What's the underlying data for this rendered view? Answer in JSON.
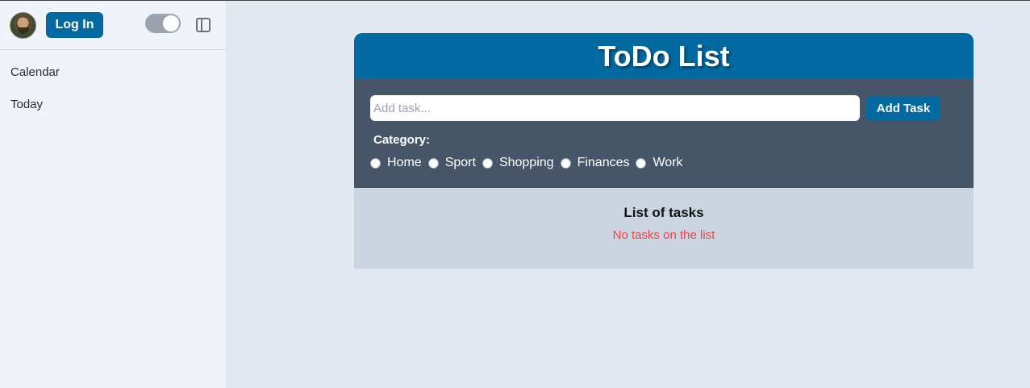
{
  "header": {
    "login_label": "Log In"
  },
  "sidebar": {
    "items": [
      {
        "label": "Calendar"
      },
      {
        "label": "Today"
      }
    ]
  },
  "todo": {
    "title": "ToDo List",
    "input_placeholder": "Add task...",
    "add_button_label": "Add Task",
    "category_label": "Category:",
    "categories": [
      {
        "label": "Home"
      },
      {
        "label": "Sport"
      },
      {
        "label": "Shopping"
      },
      {
        "label": "Finances"
      },
      {
        "label": "Work"
      }
    ],
    "list_title": "List of tasks",
    "empty_message": "No tasks on the list"
  },
  "colors": {
    "accent": "#0369a1",
    "form_bg": "#475569",
    "list_bg": "#cbd5e1",
    "empty_text": "#ef4444"
  },
  "icons": {
    "theme_toggle": "toggle-icon",
    "sidebar_toggle": "sidebar-panel-icon"
  }
}
